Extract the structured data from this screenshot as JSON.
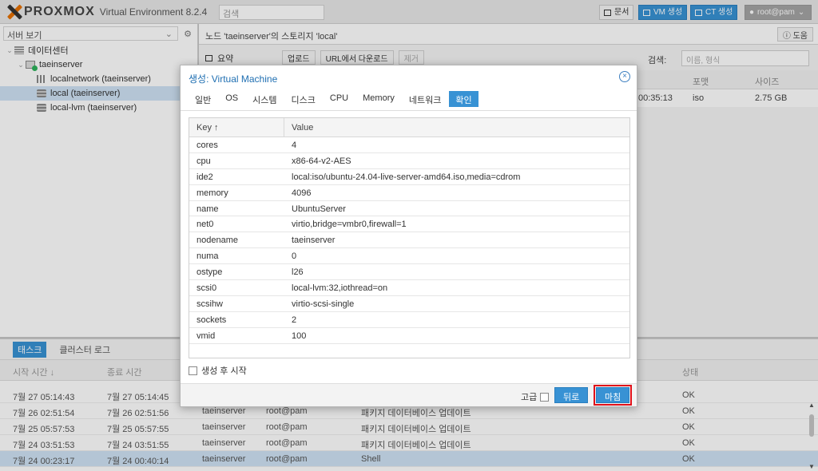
{
  "app": {
    "logo_text": "PROXMOX",
    "logo_sub": "Virtual Environment 8.2.4",
    "search_placeholder": "검색",
    "docs_label": "문서",
    "create_vm_label": "VM 생성",
    "create_ct_label": "CT 생성",
    "user_label": "root@pam"
  },
  "sidebar": {
    "view_label": "서버 보기",
    "tree": [
      {
        "label": "데이터센터",
        "icon": "datacenter-icon"
      },
      {
        "label": "taeinserver",
        "icon": "node-icon"
      },
      {
        "label": "localnetwork (taeinserver)",
        "icon": "network-icon"
      },
      {
        "label": "local (taeinserver)",
        "icon": "storage-icon"
      },
      {
        "label": "local-lvm (taeinserver)",
        "icon": "storage-icon"
      }
    ]
  },
  "content": {
    "breadcrumb": "노드 'taeinserver'의 스토리지 'local'",
    "help_label": "도움",
    "side_item": "요약",
    "upload_label": "업로드",
    "download_url_label": "URL에서 다운로드",
    "remove_label": "제거",
    "search_label": "검색:",
    "search_placeholder": "이름, 형식",
    "columns": [
      "포맷",
      "사이즈"
    ],
    "row": {
      "time_fragment": "00:35:13",
      "format": "iso",
      "size": "2.75 GB"
    }
  },
  "tasklog": {
    "tabs": [
      "태스크",
      "클러스터 로그"
    ],
    "columns": [
      "시작 시간 ↓",
      "종료 시간",
      "상태"
    ],
    "rows": [
      {
        "start": "7월 27 05:14:43",
        "end": "7월 27 05:14:45",
        "node": "",
        "user": "",
        "desc": "",
        "status": "OK"
      },
      {
        "start": "7월 26 02:51:54",
        "end": "7월 26 02:51:56",
        "node": "taeinserver",
        "user": "root@pam",
        "desc": "패키지 데이터베이스 업데이트",
        "status": "OK"
      },
      {
        "start": "7월 25 05:57:53",
        "end": "7월 25 05:57:55",
        "node": "taeinserver",
        "user": "root@pam",
        "desc": "패키지 데이터베이스 업데이트",
        "status": "OK"
      },
      {
        "start": "7월 24 03:51:53",
        "end": "7월 24 03:51:55",
        "node": "taeinserver",
        "user": "root@pam",
        "desc": "패키지 데이터베이스 업데이트",
        "status": "OK"
      },
      {
        "start": "7월 24 00:23:17",
        "end": "7월 24 00:40:14",
        "node": "taeinserver",
        "user": "root@pam",
        "desc": "Shell",
        "status": "OK"
      }
    ]
  },
  "dialog": {
    "title": "생성: Virtual Machine",
    "tabs": [
      "일반",
      "OS",
      "시스템",
      "디스크",
      "CPU",
      "Memory",
      "네트워크",
      "확인"
    ],
    "active_tab": "확인",
    "grid_headers": {
      "key": "Key ↑",
      "value": "Value"
    },
    "rows": [
      {
        "key": "cores",
        "value": "4"
      },
      {
        "key": "cpu",
        "value": "x86-64-v2-AES"
      },
      {
        "key": "ide2",
        "value": "local:iso/ubuntu-24.04-live-server-amd64.iso,media=cdrom"
      },
      {
        "key": "memory",
        "value": "4096"
      },
      {
        "key": "name",
        "value": "UbuntuServer"
      },
      {
        "key": "net0",
        "value": "virtio,bridge=vmbr0,firewall=1"
      },
      {
        "key": "nodename",
        "value": "taeinserver"
      },
      {
        "key": "numa",
        "value": "0"
      },
      {
        "key": "ostype",
        "value": "l26"
      },
      {
        "key": "scsi0",
        "value": "local-lvm:32,iothread=on"
      },
      {
        "key": "scsihw",
        "value": "virtio-scsi-single"
      },
      {
        "key": "sockets",
        "value": "2"
      },
      {
        "key": "vmid",
        "value": "100"
      }
    ],
    "start_after_create": "생성 후 시작",
    "advanced_label": "고급",
    "back_label": "뒤로",
    "finish_label": "마침"
  }
}
